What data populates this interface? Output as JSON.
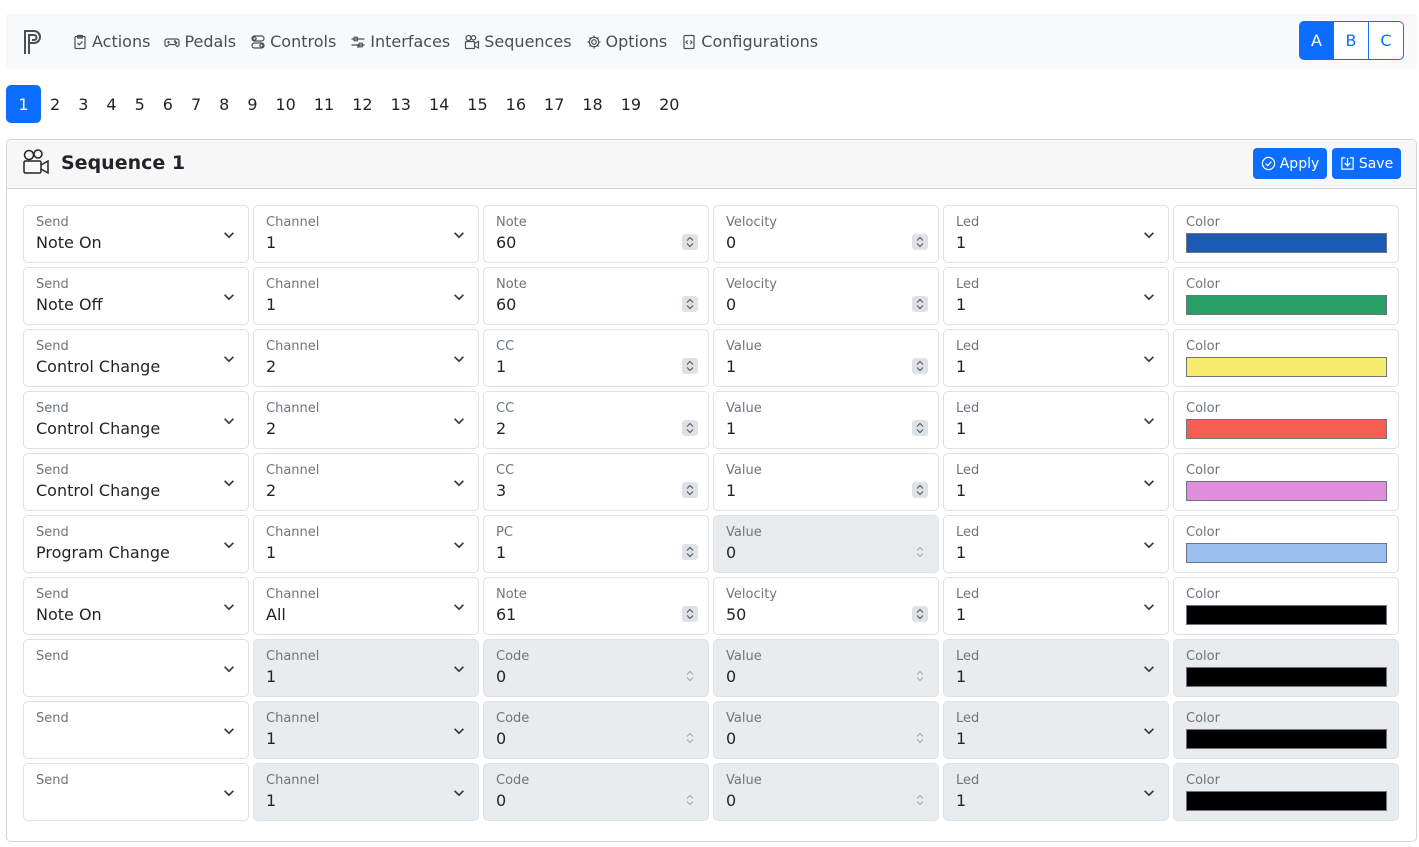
{
  "nav": {
    "items": [
      {
        "label": "Actions",
        "icon": "clipboard-check-icon"
      },
      {
        "label": "Pedals",
        "icon": "gamepad-icon"
      },
      {
        "label": "Controls",
        "icon": "toggles-icon"
      },
      {
        "label": "Interfaces",
        "icon": "sliders-icon"
      },
      {
        "label": "Sequences",
        "icon": "camera-reels-icon"
      },
      {
        "label": "Options",
        "icon": "gear-icon"
      },
      {
        "label": "Configurations",
        "icon": "file-code-icon"
      }
    ],
    "banks": [
      "A",
      "B",
      "C"
    ],
    "active_bank": "A"
  },
  "sequence_tabs": [
    "1",
    "2",
    "3",
    "4",
    "5",
    "6",
    "7",
    "8",
    "9",
    "10",
    "11",
    "12",
    "13",
    "14",
    "15",
    "16",
    "17",
    "18",
    "19",
    "20"
  ],
  "active_sequence": "1",
  "card": {
    "title": "Sequence 1",
    "apply_label": "Apply",
    "save_label": "Save"
  },
  "rows": [
    {
      "send": "Note On",
      "channel": "1",
      "p1_label": "Note",
      "p1": "60",
      "p2_label": "Velocity",
      "p2": "0",
      "led": "1",
      "color": "#1a5cb5",
      "p1_disabled": false,
      "p2_disabled": false,
      "row_disabled": false
    },
    {
      "send": "Note Off",
      "channel": "1",
      "p1_label": "Note",
      "p1": "60",
      "p2_label": "Velocity",
      "p2": "0",
      "led": "1",
      "color": "#28a065",
      "p1_disabled": false,
      "p2_disabled": false,
      "row_disabled": false
    },
    {
      "send": "Control Change",
      "channel": "2",
      "p1_label": "CC",
      "p1": "1",
      "p2_label": "Value",
      "p2": "1",
      "led": "1",
      "color": "#f7ec6e",
      "p1_disabled": false,
      "p2_disabled": false,
      "row_disabled": false
    },
    {
      "send": "Control Change",
      "channel": "2",
      "p1_label": "CC",
      "p1": "2",
      "p2_label": "Value",
      "p2": "1",
      "led": "1",
      "color": "#f55f52",
      "p1_disabled": false,
      "p2_disabled": false,
      "row_disabled": false
    },
    {
      "send": "Control Change",
      "channel": "2",
      "p1_label": "CC",
      "p1": "3",
      "p2_label": "Value",
      "p2": "1",
      "led": "1",
      "color": "#e08ddc",
      "p1_disabled": false,
      "p2_disabled": false,
      "row_disabled": false
    },
    {
      "send": "Program Change",
      "channel": "1",
      "p1_label": "PC",
      "p1": "1",
      "p2_label": "Value",
      "p2": "0",
      "led": "1",
      "color": "#9bc0f0",
      "p1_disabled": false,
      "p2_disabled": true,
      "row_disabled": false
    },
    {
      "send": "Note On",
      "channel": "All",
      "p1_label": "Note",
      "p1": "61",
      "p2_label": "Velocity",
      "p2": "50",
      "led": "1",
      "color": "#000000",
      "p1_disabled": false,
      "p2_disabled": false,
      "row_disabled": false
    },
    {
      "send": "",
      "channel": "1",
      "p1_label": "Code",
      "p1": "0",
      "p2_label": "Value",
      "p2": "0",
      "led": "1",
      "color": "#000000",
      "p1_disabled": true,
      "p2_disabled": true,
      "row_disabled": true
    },
    {
      "send": "",
      "channel": "1",
      "p1_label": "Code",
      "p1": "0",
      "p2_label": "Value",
      "p2": "0",
      "led": "1",
      "color": "#000000",
      "p1_disabled": true,
      "p2_disabled": true,
      "row_disabled": true
    },
    {
      "send": "",
      "channel": "1",
      "p1_label": "Code",
      "p1": "0",
      "p2_label": "Value",
      "p2": "0",
      "led": "1",
      "color": "#000000",
      "p1_disabled": true,
      "p2_disabled": true,
      "row_disabled": true
    }
  ],
  "field_labels": {
    "send": "Send",
    "channel": "Channel",
    "led": "Led",
    "color": "Color"
  },
  "colors": {
    "accent": "#0d6efd",
    "disabled_bg": "#e9ecef"
  }
}
